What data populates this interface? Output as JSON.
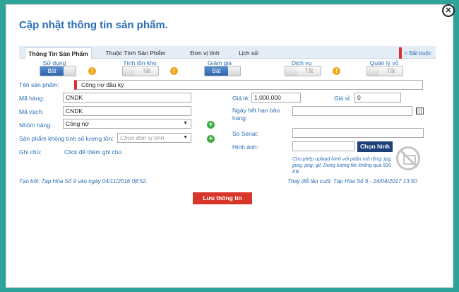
{
  "dialog": {
    "title": "Cập nhật thông tin sản phẩm.",
    "close_icon": "x-circle-icon"
  },
  "tabs": [
    "Thông Tin Sản Phẩm",
    "Thuộc Tính Sản Phẩm",
    "Đơn vị tính",
    "Lịch sử"
  ],
  "active_tab": "Thông Tin Sản Phẩm",
  "required_note": "= Bắt buộc",
  "toggles": [
    {
      "label": "Sử dụng",
      "state_text": "Bật",
      "on": true,
      "has_help": true
    },
    {
      "label": "Tính tồn kho",
      "state_text": "Tắt",
      "on": false,
      "has_help": true
    },
    {
      "label": "Giảm giá",
      "state_text": "Bật",
      "on": true,
      "has_help": false
    },
    {
      "label": "Dịch vụ",
      "state_text": "Tắt",
      "on": false,
      "has_help": true
    },
    {
      "label": "Quản lý vỏ",
      "state_text": "Tắt",
      "on": false,
      "has_help": false
    }
  ],
  "form": {
    "product_name_label": "Tên sản phẩm:",
    "product_name_value": "Công nợ đầu kỳ",
    "code_label": "Mã hàng:",
    "code_value": "CNDK",
    "barcode_label": "Mã vạch:",
    "barcode_value": "CNDK",
    "group_label": "Nhóm hàng:",
    "group_value": "Công nợ",
    "unit_label": "Sản phẩm không tính số lượng tồn:",
    "unit_placeholder": "Chọn đơn vị tính",
    "note_label": "Ghi chú:",
    "note_link": "Click để thêm ghi chú",
    "retail_label": "Giá lẻ:",
    "retail_value": "1,000,000",
    "wholesale_label": "Giá sỉ:",
    "wholesale_value": "0",
    "warranty_label": "Ngày hết hạn bảo hàng:",
    "warranty_value": "",
    "serial_label": "So Serial:",
    "serial_value": "",
    "image_label": "Hình ảnh:",
    "image_value": "",
    "choose_image_button": "Chọn hình",
    "image_hint": "Cho phép upload hình với phần mở rộng: jpg, jpeg, png, gif. Dung lượng file không quá 500 KB"
  },
  "footer": {
    "created_by": "Tạo bởi: Tạp Hóa Số 9 vào ngày 04/11/2016 08:52.",
    "modified_by": "Thay đổi lần cuối: Tạp Hóa Số 9 - 24/04/2017 13:50",
    "save_button": "Lưu thông tin"
  },
  "colors": {
    "background": "#2ea39a",
    "accent": "#2a6eb5",
    "required": "#e03131",
    "save": "#d9362b",
    "choose": "#1d3f7a"
  }
}
